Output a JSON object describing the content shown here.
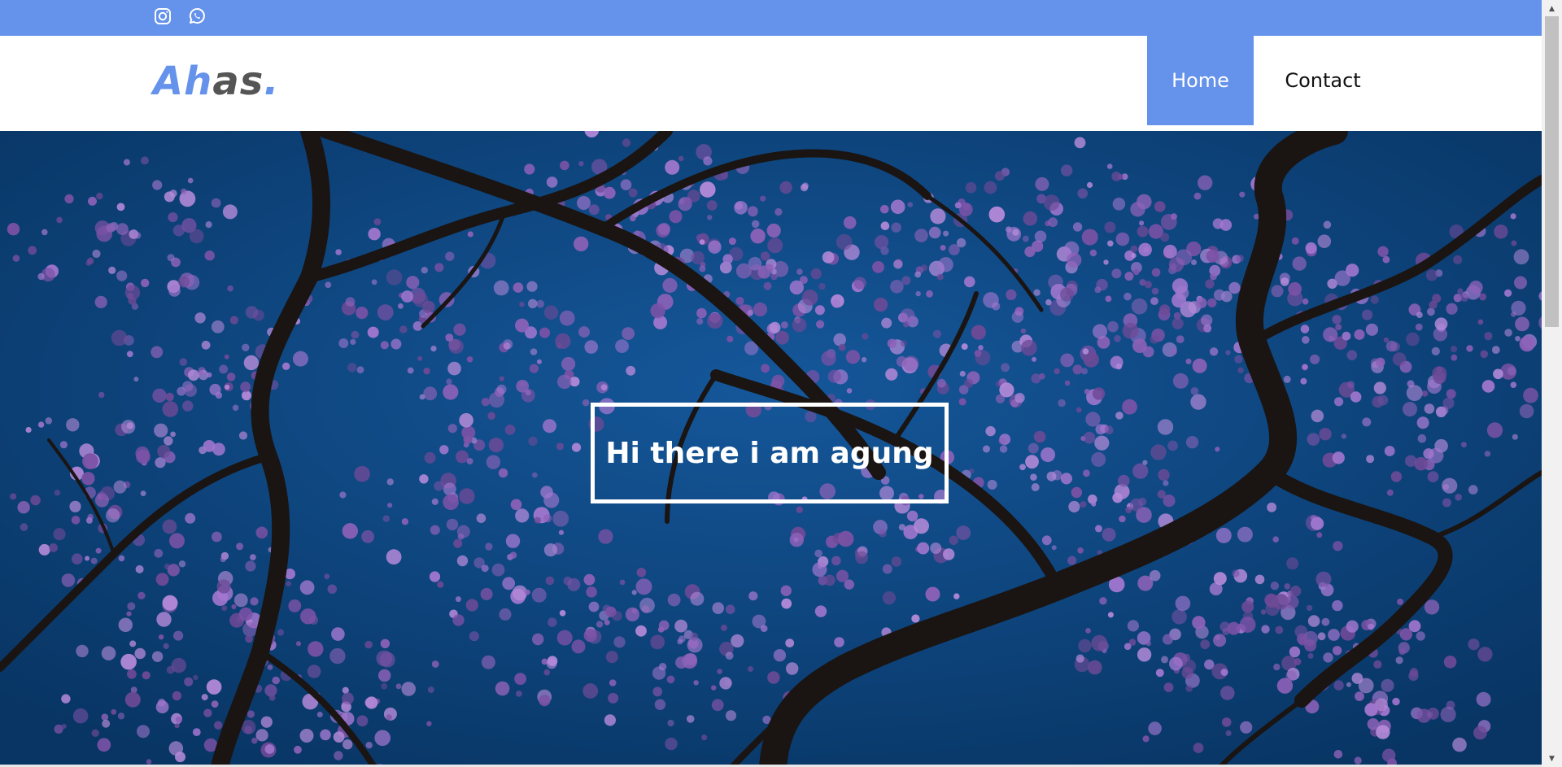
{
  "topbar": {
    "color": "#6592ea",
    "icons": [
      "instagram-icon",
      "whatsapp-icon"
    ]
  },
  "header": {
    "logo": {
      "part1": "Ah",
      "part2": "as",
      "part3": ".",
      "accent_color": "#6592ea",
      "secondary_color": "#555555"
    },
    "nav": [
      {
        "label": "Home",
        "active": true
      },
      {
        "label": "Contact",
        "active": false
      }
    ]
  },
  "hero": {
    "title": "Hi there i am agung",
    "sky_color": "#0a3f77",
    "blossom_color": "#9a6fc4"
  },
  "scrollbar": {
    "up_arrow": "▲",
    "down_arrow": "▼"
  }
}
